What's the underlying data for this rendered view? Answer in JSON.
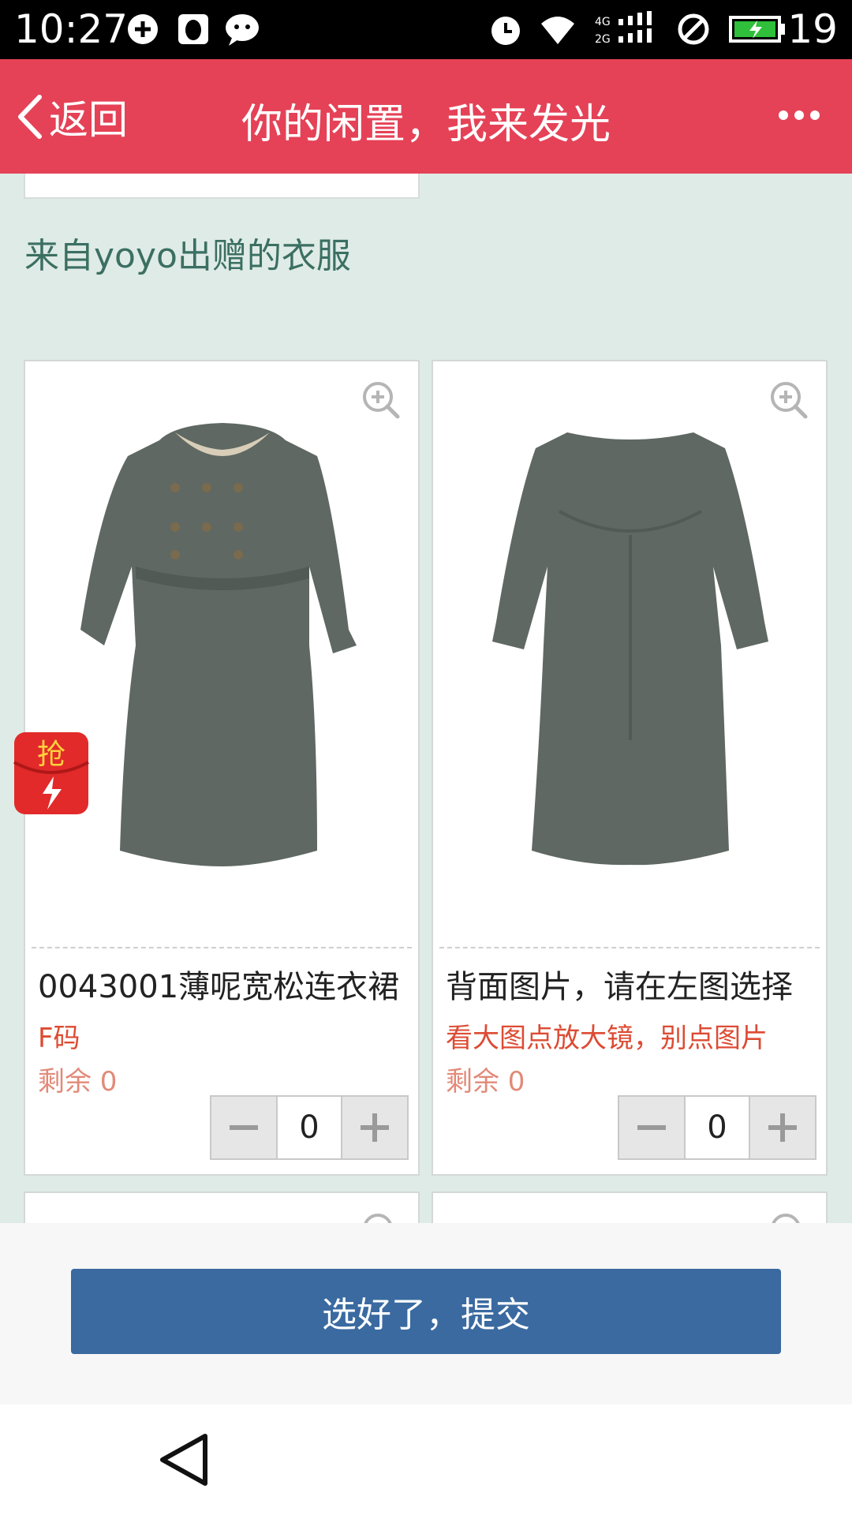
{
  "status_bar": {
    "time": "10:27",
    "battery_level": "19",
    "icons": [
      "sync-icon",
      "qq-icon",
      "chat-bubble-icon",
      "alarm-icon",
      "wifi-icon",
      "signal-4g-2g-icon",
      "no-disturb-icon",
      "battery-charging-icon"
    ]
  },
  "header": {
    "back_label": "返回",
    "title": "你的闲置，我来发光",
    "more_icon": "more-dots-icon"
  },
  "section": {
    "title": "来自yoyo出赠的衣服"
  },
  "products": [
    {
      "name": "0043001薄呢宽松连衣裙",
      "line1": "F码",
      "line2": "剩余 0",
      "quantity": "0",
      "image": "gray-wool-dress-front"
    },
    {
      "name": "背面图片，请在左图选择",
      "line1": "看大图点放大镜，别点图片",
      "line2": "剩余 0",
      "quantity": "0",
      "image": "gray-wool-dress-back"
    }
  ],
  "badge": {
    "text": "抢"
  },
  "actions": {
    "submit_label": "选好了，提交"
  },
  "colors": {
    "header": "#e54257",
    "background": "#dfebe6",
    "submit": "#3a6aa0",
    "accent_text": "#dd4b33"
  }
}
